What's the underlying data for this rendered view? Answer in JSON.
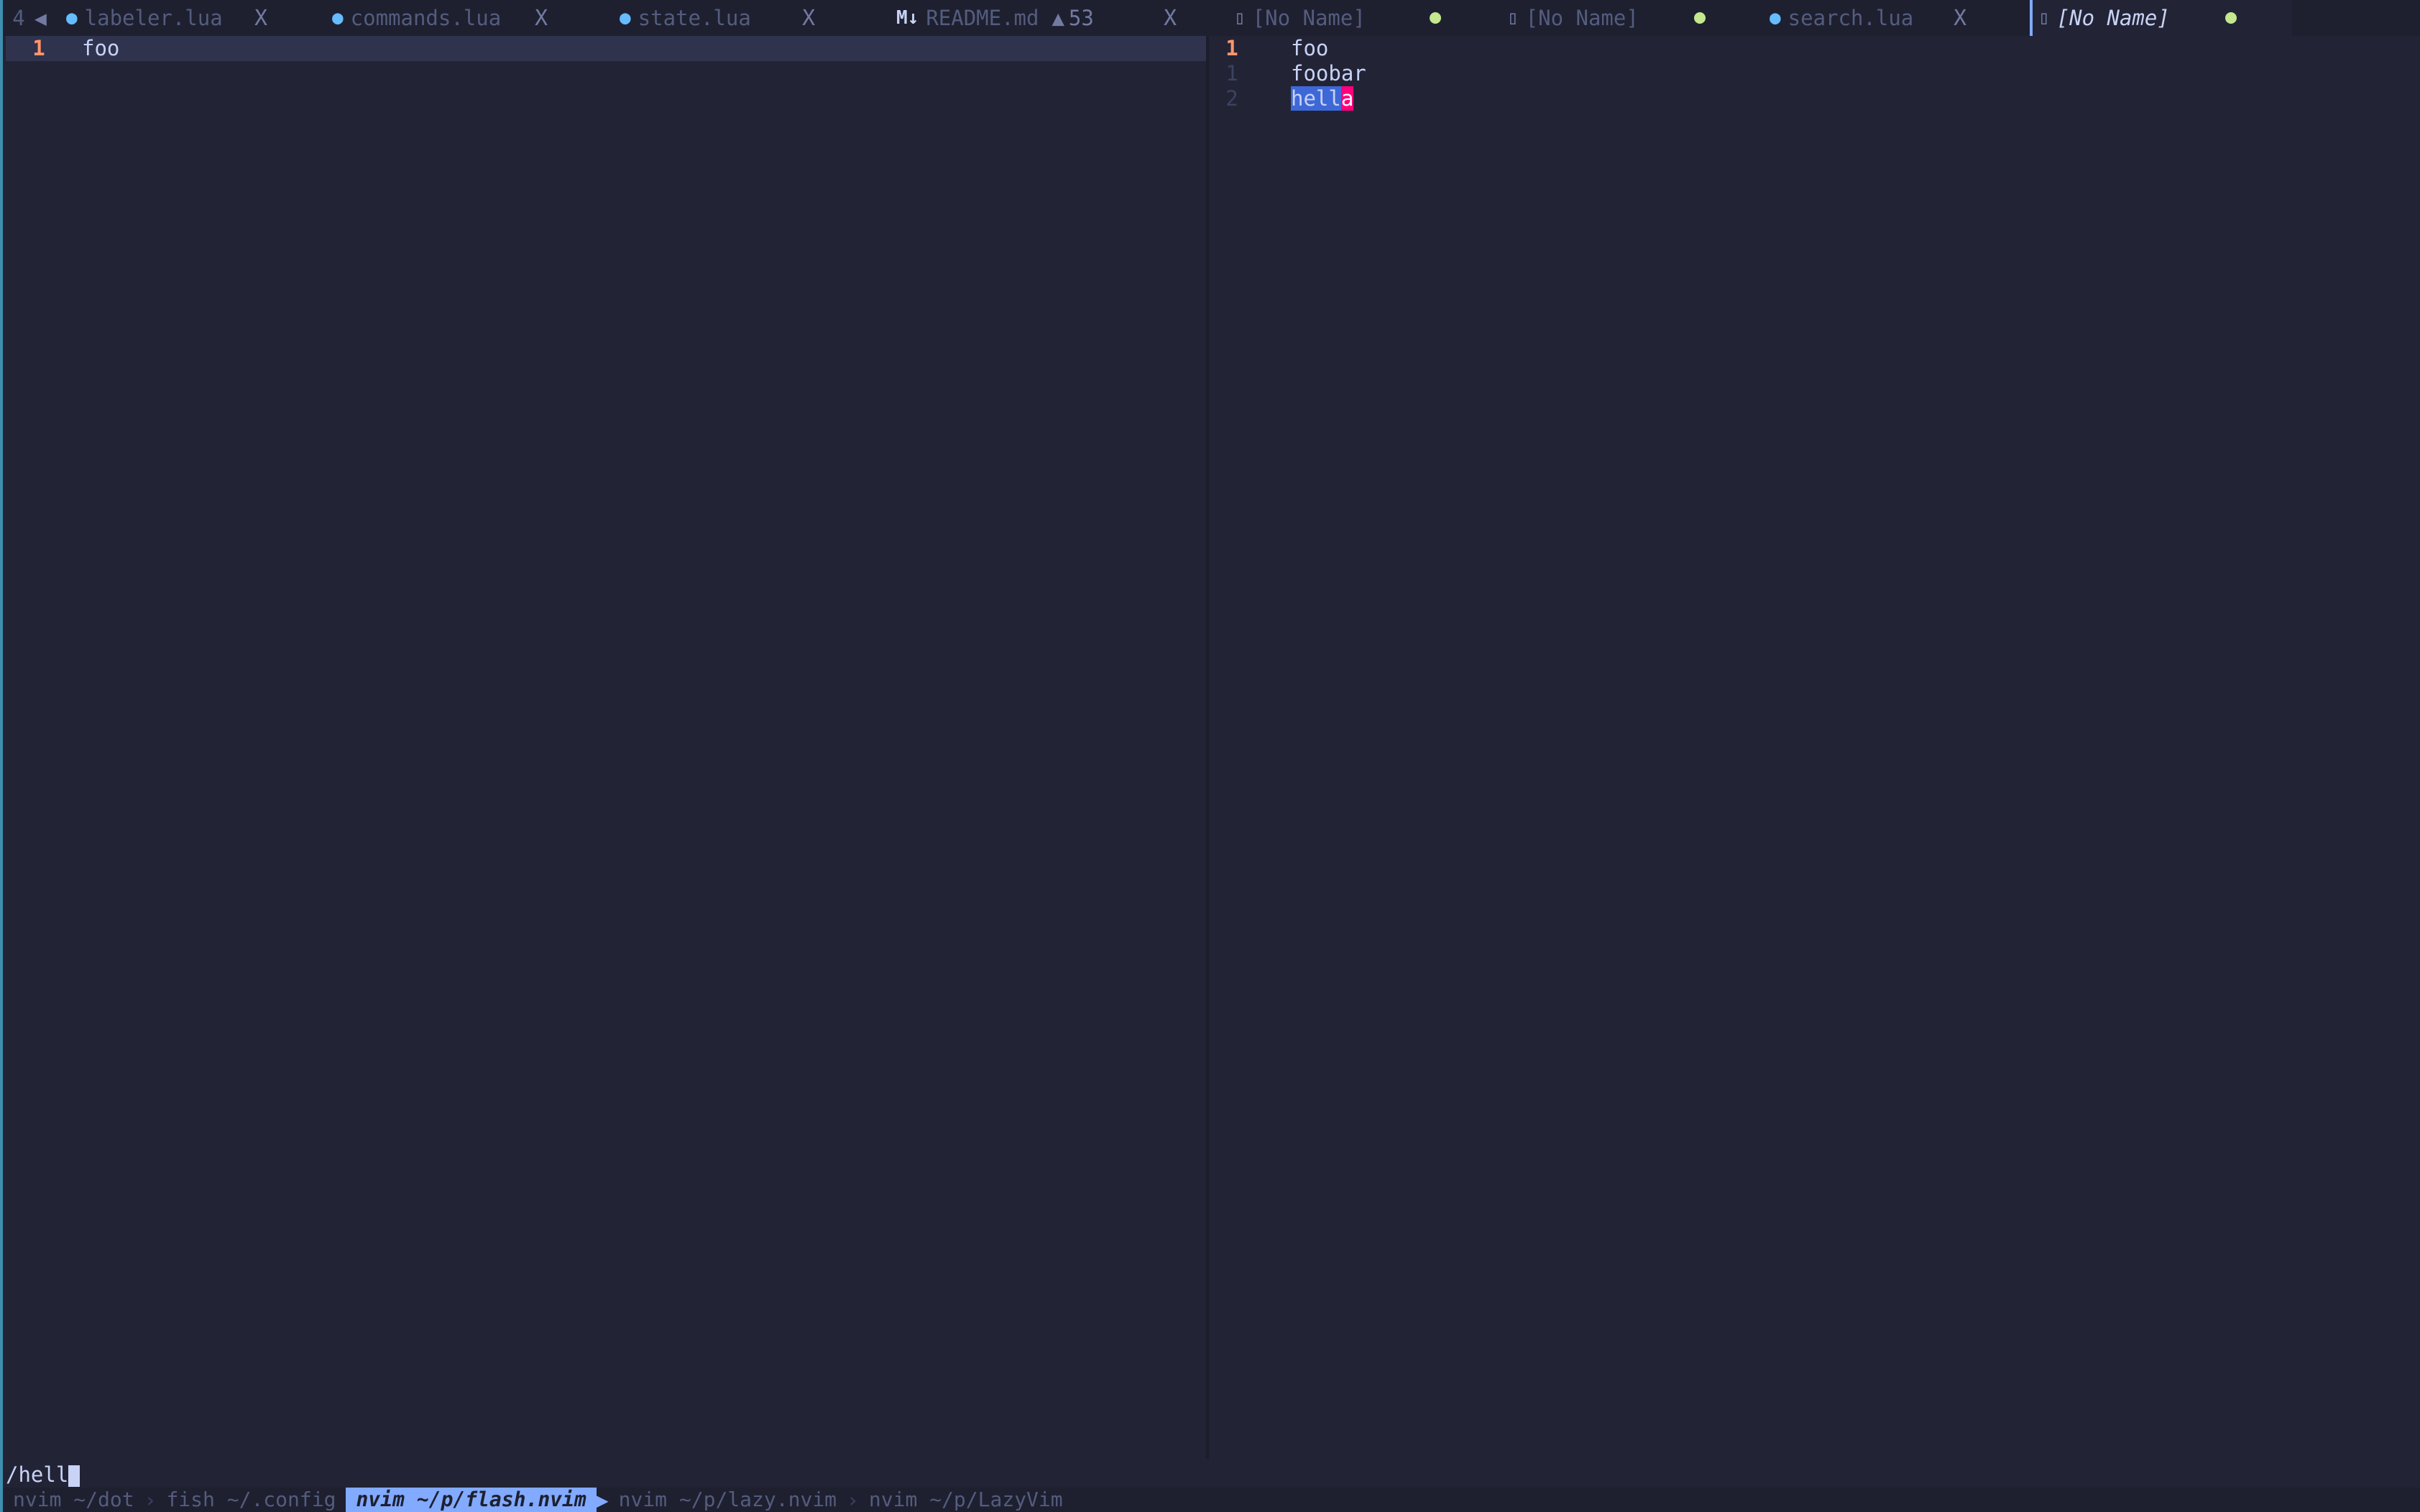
{
  "tabline": {
    "buffer_count": "4",
    "tabs": [
      {
        "icon": "lua-icon",
        "label": "labeler.lua",
        "close": "X"
      },
      {
        "icon": "lua-icon",
        "label": "commands.lua",
        "close": "X"
      },
      {
        "icon": "lua-icon",
        "label": "state.lua",
        "close": "X"
      },
      {
        "icon": "markdown-icon",
        "icon_text": "M↓",
        "label": "README.md",
        "warnings": "53",
        "close": "X"
      },
      {
        "icon": "file-icon",
        "label": "[No Name]",
        "modified": true
      },
      {
        "icon": "file-icon",
        "label": "[No Name]",
        "modified": true
      },
      {
        "icon": "lua-icon",
        "label": "search.lua",
        "close": "X"
      },
      {
        "icon": "file-icon",
        "label": "[No Name]",
        "modified": true,
        "active": true
      }
    ]
  },
  "left_pane": {
    "lines": [
      {
        "number": "1",
        "text": "foo",
        "current": true
      }
    ]
  },
  "right_pane": {
    "lines": [
      {
        "number": "1",
        "text": "foo",
        "current": true
      },
      {
        "number": "1",
        "text": "foobar"
      },
      {
        "number": "2",
        "match_text": "hell",
        "label_text": "a"
      }
    ]
  },
  "cmdline": {
    "text": "/hell"
  },
  "terminal_tabs": [
    {
      "label": "nvim ~/dot"
    },
    {
      "label": "fish ~/.config"
    },
    {
      "label": "nvim ~/p/flash.nvim",
      "active": true
    },
    {
      "label": "nvim ~/p/lazy.nvim"
    },
    {
      "label": "nvim ~/p/LazyVim"
    }
  ],
  "colors": {
    "background": "#222436",
    "tabline_bg": "#1e2030",
    "cursor_line": "#2f334d",
    "current_line_nr": "#ff966c",
    "search_match": "#3e68d7",
    "flash_label": "#ff007c",
    "modified_dot": "#c3e88d",
    "active_terminal_tab": "#82aaff"
  }
}
